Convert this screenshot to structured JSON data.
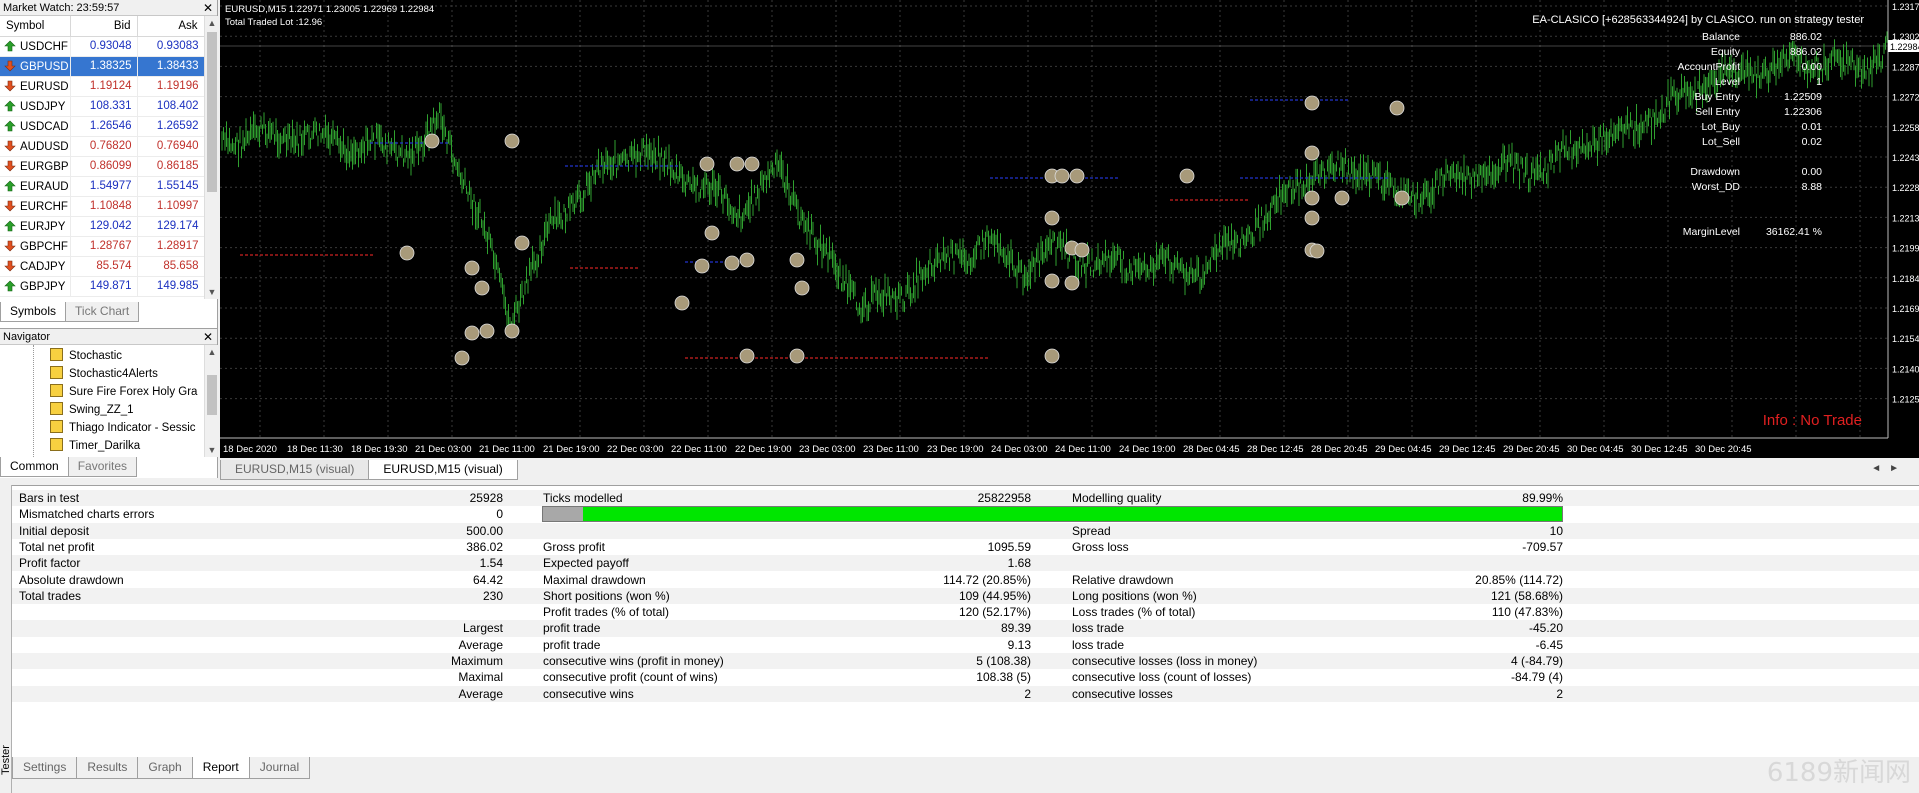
{
  "market_watch": {
    "title": "Market Watch: 23:59:57",
    "headers": {
      "symbol": "Symbol",
      "bid": "Bid",
      "ask": "Ask"
    },
    "rows": [
      {
        "symbol": "USDCHF",
        "bid": "0.93048",
        "ask": "0.93083",
        "dir": "up"
      },
      {
        "symbol": "GBPUSD",
        "bid": "1.38325",
        "ask": "1.38433",
        "dir": "down"
      },
      {
        "symbol": "EURUSD",
        "bid": "1.19124",
        "ask": "1.19196",
        "dir": "down"
      },
      {
        "symbol": "USDJPY",
        "bid": "108.331",
        "ask": "108.402",
        "dir": "up"
      },
      {
        "symbol": "USDCAD",
        "bid": "1.26546",
        "ask": "1.26592",
        "dir": "up"
      },
      {
        "symbol": "AUDUSD",
        "bid": "0.76820",
        "ask": "0.76940",
        "dir": "down"
      },
      {
        "symbol": "EURGBP",
        "bid": "0.86099",
        "ask": "0.86185",
        "dir": "down"
      },
      {
        "symbol": "EURAUD",
        "bid": "1.54977",
        "ask": "1.55145",
        "dir": "up"
      },
      {
        "symbol": "EURCHF",
        "bid": "1.10848",
        "ask": "1.10997",
        "dir": "down"
      },
      {
        "symbol": "EURJPY",
        "bid": "129.042",
        "ask": "129.174",
        "dir": "up"
      },
      {
        "symbol": "GBPCHF",
        "bid": "1.28767",
        "ask": "1.28917",
        "dir": "down"
      },
      {
        "symbol": "CADJPY",
        "bid": "85.574",
        "ask": "85.658",
        "dir": "down"
      },
      {
        "symbol": "GBPJPY",
        "bid": "149.871",
        "ask": "149.985",
        "dir": "up"
      }
    ],
    "tabs": [
      "Symbols",
      "Tick Chart"
    ]
  },
  "navigator": {
    "title": "Navigator",
    "items": [
      "Stochastic",
      "Stochastic4Alerts",
      "Sure Fire Forex Holy Gra",
      "Swing_ZZ_1",
      "Thiago Indicator - Sessic",
      "Timer_Darilka"
    ],
    "tabs": [
      "Common",
      "Favorites"
    ]
  },
  "chart": {
    "header_line1": "EURUSD,M15  1.22971 1.23005 1.22969 1.22984",
    "header_line2": "Total Traded Lot :12.96",
    "ea_title": "EA-CLASICO [+628563344924] by CLASICO. run on strategy tester",
    "info_labels": [
      {
        "label": "Balance",
        "value": "886.02"
      },
      {
        "label": "Equity",
        "value": "886.02"
      },
      {
        "label": "AccountProfit",
        "value": "0.00"
      },
      {
        "label": "Level",
        "value": "1"
      },
      {
        "label": "Buy Entry",
        "value": "1.22509"
      },
      {
        "label": "Sell Entry",
        "value": "1.22306"
      },
      {
        "label": "Lot_Buy",
        "value": "0.01"
      },
      {
        "label": "Lot_Sell",
        "value": "0.02"
      },
      {
        "label": "Drawdown",
        "value": "0.00"
      },
      {
        "label": "Worst_DD",
        "value": "8.88"
      },
      {
        "label": "MarginLevel",
        "value": "36162.41 %"
      }
    ],
    "info_status": "Info : No Trade",
    "price_ticks": [
      "1.23170",
      "1.23020",
      "1.22875",
      "1.22725",
      "1.22580",
      "1.22430",
      "1.22285",
      "1.22135",
      "1.21990",
      "1.21840",
      "1.21695",
      "1.21545",
      "1.21400",
      "1.21250"
    ],
    "current_price": "1.22984",
    "time_ticks": [
      "18 Dec 2020",
      "18 Dec 11:30",
      "18 Dec 19:30",
      "21 Dec 03:00",
      "21 Dec 11:00",
      "21 Dec 19:00",
      "22 Dec 03:00",
      "22 Dec 11:00",
      "22 Dec 19:00",
      "23 Dec 03:00",
      "23 Dec 11:00",
      "23 Dec 19:00",
      "24 Dec 03:00",
      "24 Dec 11:00",
      "24 Dec 19:00",
      "28 Dec 04:45",
      "28 Dec 12:45",
      "28 Dec 20:45",
      "29 Dec 04:45",
      "29 Dec 12:45",
      "29 Dec 20:45",
      "30 Dec 04:45",
      "30 Dec 12:45",
      "30 Dec 20:45"
    ],
    "tabs": [
      "EURUSD,M15 (visual)",
      "EURUSD,M15 (visual)"
    ],
    "colors": {
      "background": "#000000",
      "candles": "#2fa02f",
      "grid": "#3a3a3a",
      "buy_line": "#2233cc",
      "sell_line": "#cc2222",
      "status": "#e02020"
    }
  },
  "report": {
    "rows": [
      [
        "Bars in test",
        "25928",
        "Ticks modelled",
        "25822958",
        "Modelling quality",
        "89.99%"
      ],
      [
        "Mismatched charts errors",
        "0",
        "",
        "",
        "",
        ""
      ],
      [
        "Initial deposit",
        "500.00",
        "",
        "",
        "Spread",
        "10"
      ],
      [
        "Total net profit",
        "386.02",
        "Gross profit",
        "1095.59",
        "Gross loss",
        "-709.57"
      ],
      [
        "Profit factor",
        "1.54",
        "Expected payoff",
        "1.68",
        "",
        ""
      ],
      [
        "Absolute drawdown",
        "64.42",
        "Maximal drawdown",
        "114.72 (20.85%)",
        "Relative drawdown",
        "20.85% (114.72)"
      ],
      [
        "Total trades",
        "230",
        "Short positions (won %)",
        "109 (44.95%)",
        "Long positions (won %)",
        "121 (58.68%)"
      ],
      [
        "",
        "",
        "Profit trades (% of total)",
        "120 (52.17%)",
        "Loss trades (% of total)",
        "110 (47.83%)"
      ],
      [
        "",
        "Largest",
        "profit trade",
        "89.39",
        "loss trade",
        "-45.20"
      ],
      [
        "",
        "Average",
        "profit trade",
        "9.13",
        "loss trade",
        "-6.45"
      ],
      [
        "",
        "Maximum",
        "consecutive wins (profit in money)",
        "5 (108.38)",
        "consecutive losses (loss in money)",
        "4 (-84.79)"
      ],
      [
        "",
        "Maximal",
        "consecutive profit (count of wins)",
        "108.38 (5)",
        "consecutive loss (count of losses)",
        "-84.79 (4)"
      ],
      [
        "",
        "Average",
        "consecutive wins",
        "2",
        "consecutive losses",
        "2"
      ]
    ],
    "modelling_quality": 0.9
  },
  "tester": {
    "side_label": "Tester",
    "tabs": [
      "Settings",
      "Results",
      "Graph",
      "Report",
      "Journal"
    ],
    "active_tab": "Report"
  },
  "watermark": "6189新闻网"
}
